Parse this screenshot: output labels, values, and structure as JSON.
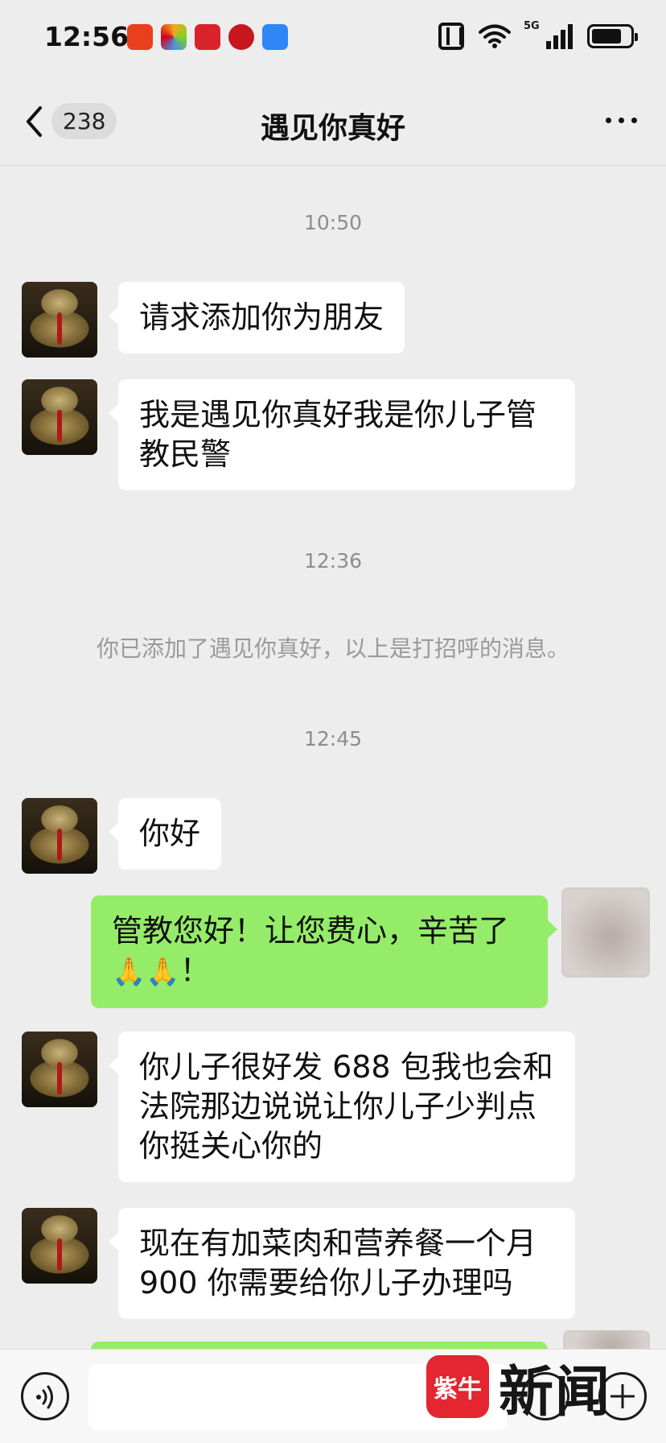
{
  "status_bar": {
    "time": "12:56",
    "network_label": "5G",
    "app_icons": [
      {
        "name": "app-icon-red-shop",
        "color": "#e8401c"
      },
      {
        "name": "app-icon-colorful",
        "color": "#f4f4f4"
      },
      {
        "name": "app-icon-red-heart",
        "color": "#d8232a"
      },
      {
        "name": "app-icon-bank",
        "color": "#c8161e"
      },
      {
        "name": "app-icon-blue-folder",
        "color": "#2f86f6"
      }
    ]
  },
  "nav": {
    "unread_count": "238",
    "title": "遇见你真好"
  },
  "messages": {
    "ts1": "10:50",
    "m1": "请求添加你为朋友",
    "m2_line1": "我是遇见你真好我是你儿子管",
    "m2_line2": "教民警",
    "ts2": "12:36",
    "system": "你已添加了遇见你真好，以上是打招呼的消息。",
    "ts3": "12:45",
    "m3": "你好",
    "m4_line1": "管教您好！让您费心，辛苦了",
    "m4_emoji": "🙏🙏",
    "m4_tail": "！",
    "m5_line1": "你儿子很好发 688 包我也会和",
    "m5_line2": "法院那边说说让你儿子少判点",
    "m5_line3": "你挺关心你的",
    "m6_line1": "现在有加菜肉和营养餐一个月",
    "m6_line2": "900 你需要给你儿子办理吗"
  },
  "watermark": {
    "logo_text": "紫牛",
    "text": "新闻"
  },
  "colors": {
    "background": "#ededed",
    "incoming_bubble": "#ffffff",
    "outgoing_bubble": "#95ec69",
    "timestamp": "#8d8d8d",
    "watermark_red": "#e3262f"
  }
}
